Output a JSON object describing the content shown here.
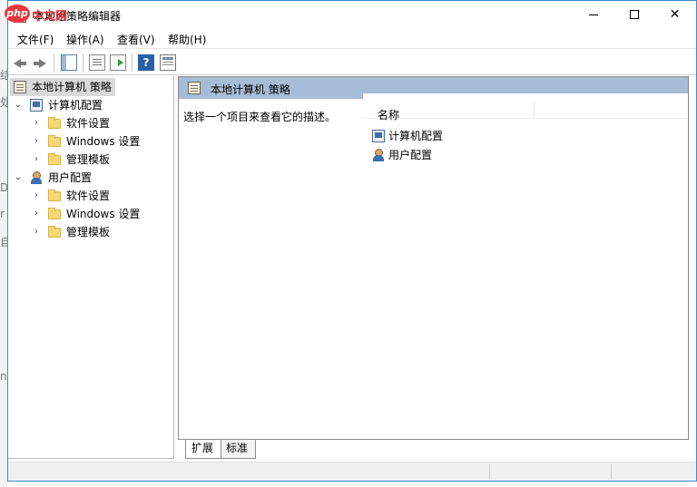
{
  "background_glyphs": [
    "结",
    "处",
    "D",
    "r",
    "自",
    "n"
  ],
  "window": {
    "title": "本地组策略编辑器",
    "watermark_brand": "php",
    "watermark_text": "中文网",
    "minimize_symbol": "",
    "maximize_symbol": "",
    "close_symbol": "✕"
  },
  "menu": {
    "items": [
      "文件(F)",
      "操作(A)",
      "查看(V)",
      "帮助(H)"
    ]
  },
  "toolbar": {
    "help_symbol": "?"
  },
  "tree": {
    "root": "本地计算机 策略",
    "computer_config": {
      "label": "计算机配置",
      "children": [
        "软件设置",
        "Windows 设置",
        "管理模板"
      ]
    },
    "user_config": {
      "label": "用户配置",
      "children": [
        "软件设置",
        "Windows 设置",
        "管理模板"
      ]
    },
    "expanded_symbol": "⌄",
    "collapsed_symbol": "›"
  },
  "details": {
    "title": "本地计算机 策略",
    "description": "选择一个项目来查看它的描述。",
    "column_name": "名称",
    "items": [
      "计算机配置",
      "用户配置"
    ]
  },
  "tabs": [
    "扩展",
    "标准"
  ],
  "icons": {
    "policy": "policy-document-icon",
    "computer": "computer-config-icon",
    "user": "user-config-icon",
    "folder": "folder-icon"
  }
}
